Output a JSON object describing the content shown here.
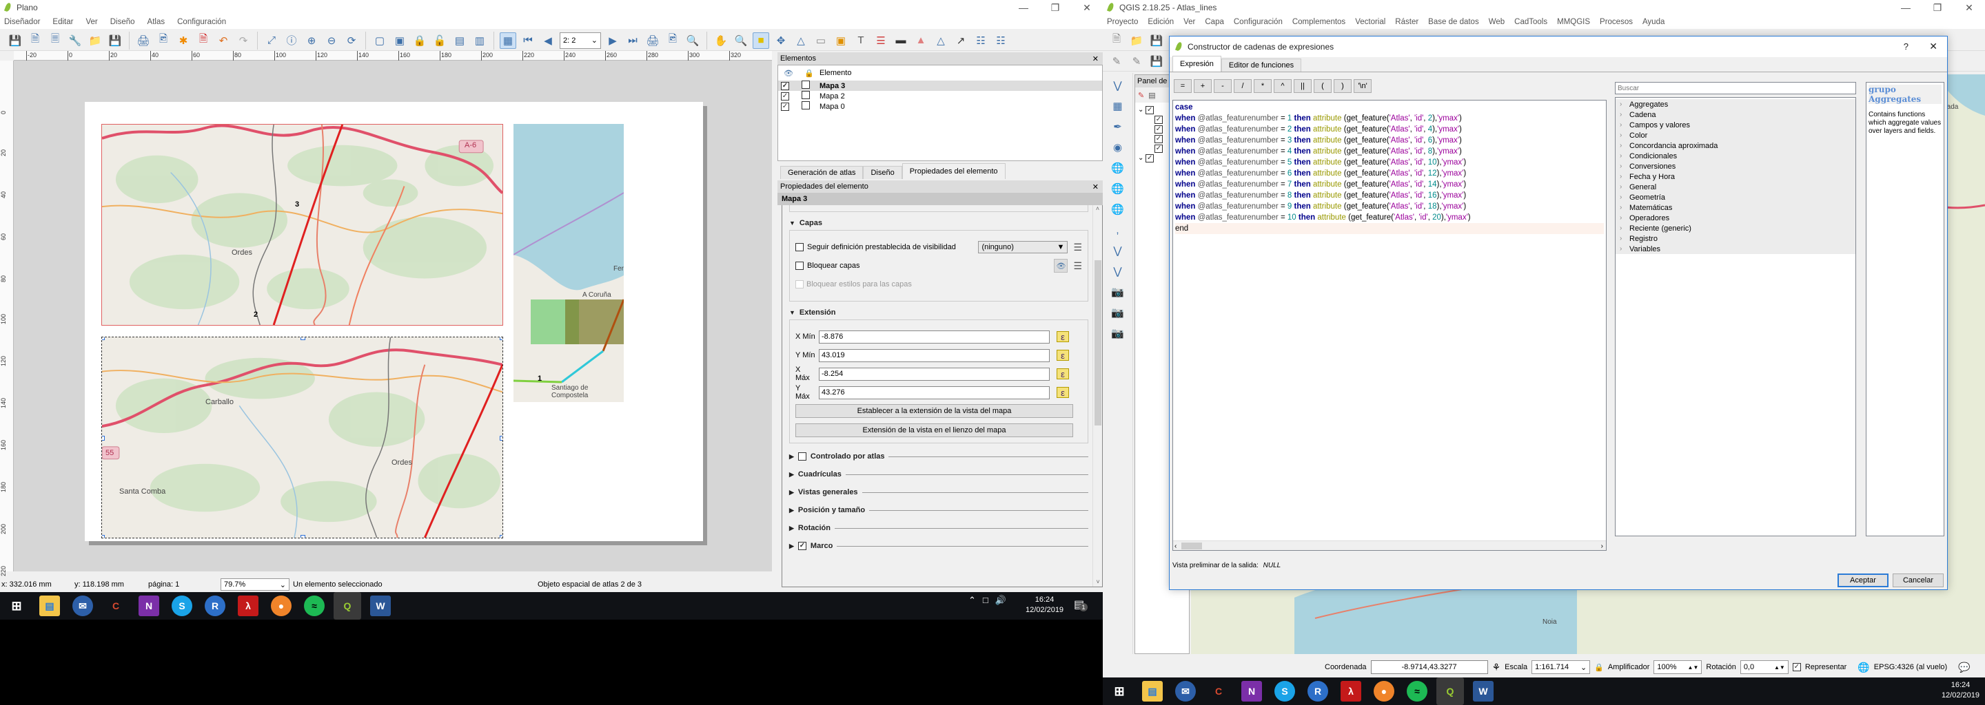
{
  "left_window": {
    "title": "Plano",
    "menu": [
      "Diseñador",
      "Editar",
      "Ver",
      "Diseño",
      "Atlas",
      "Configuración"
    ],
    "atlas_page_combo": "2: 2",
    "ruler_h": [
      "-20",
      "0",
      "20",
      "40",
      "60",
      "80",
      "100",
      "120",
      "140",
      "160",
      "180",
      "200",
      "220",
      "240",
      "260",
      "280",
      "300",
      "320"
    ],
    "ruler_v": [
      "0",
      "20",
      "40",
      "60",
      "80",
      "100",
      "120",
      "140",
      "160",
      "180",
      "200",
      "220"
    ],
    "map_labels": {
      "a6": "A-6",
      "ordes": "Ordes",
      "carballo": "Carballo",
      "ordes2": "Ordes",
      "santa_comba": "Santa Comba",
      "n55": "55",
      "ferrol": "Fer",
      "a_coruna": "A Coruña",
      "santiago": "Santiago de Compostela",
      "m1": "1",
      "m2": "2",
      "m3": "3"
    },
    "elements_panel": {
      "title": "Elementos",
      "column_header": "Elemento",
      "items": [
        {
          "name": "Mapa 3",
          "visible": true,
          "locked": false,
          "selected": true
        },
        {
          "name": "Mapa 2",
          "visible": true,
          "locked": false,
          "selected": false
        },
        {
          "name": "Mapa 0",
          "visible": true,
          "locked": false,
          "selected": false
        }
      ]
    },
    "tabs": [
      "Generación de atlas",
      "Diseño",
      "Propiedades del elemento"
    ],
    "active_tab": "Propiedades del elemento",
    "properties": {
      "title": "Propiedades del elemento",
      "item_name": "Mapa 3",
      "capas": {
        "title": "Capas",
        "follow_preset_label": "Seguir definición prestablecida de visibilidad",
        "follow_preset_checked": false,
        "preset_value": "(ninguno)",
        "lock_layers_label": "Bloquear capas",
        "lock_layers_checked": false,
        "lock_styles_label": "Bloquear estilos para las capas",
        "lock_styles_checked": false
      },
      "extent": {
        "title": "Extensión",
        "xmin_label": "X Mín",
        "xmin": "-8.876",
        "ymin_label": "Y Mín",
        "ymin": "43.019",
        "xmax_label": "X Máx",
        "xmax": "-8.254",
        "ymax_label": "Y Máx",
        "ymax": "43.276",
        "set_extent_button": "Establecer a la extensión de la vista del mapa",
        "view_extent_button": "Extensión de la vista en el lienzo del mapa"
      },
      "collapsed_sections": [
        {
          "label": "Controlado por atlas",
          "checkbox": true,
          "checked": false
        },
        {
          "label": "Cuadrículas",
          "checkbox": false
        },
        {
          "label": "Vistas generales",
          "checkbox": false
        },
        {
          "label": "Posición y tamaño",
          "checkbox": false
        },
        {
          "label": "Rotación",
          "checkbox": false
        },
        {
          "label": "Marco",
          "checkbox": true,
          "checked": true
        }
      ]
    },
    "statusbar": {
      "x": "x: 332.016 mm",
      "y": "y: 118.198 mm",
      "page": "página: 1",
      "zoom": "79.7%",
      "selection": "Un elemento seleccionado",
      "atlas": "Objeto espacial de atlas 2 de 3"
    }
  },
  "right_window": {
    "title": "QGIS 2.18.25 - Atlas_lines",
    "menu": [
      "Proyecto",
      "Edición",
      "Ver",
      "Capa",
      "Configuración",
      "Complementos",
      "Vectorial",
      "Ráster",
      "Base de datos",
      "Web",
      "CadTools",
      "MMQGIS",
      "Procesos",
      "Ayuda"
    ],
    "layers_panel_title": "Panel de capas",
    "statusbar": {
      "coord_label": "Coordenada",
      "coord_value": "-8.9714,43.3277",
      "scale_label": "Escala",
      "scale_value": "1:161.714",
      "magnifier_label": "Amplificador",
      "magnifier_value": "100%",
      "rotation_label": "Rotación",
      "rotation_value": "0,0",
      "render_label": "Representar",
      "render_checked": true,
      "crs": "EPSG:4326 (al vuelo)"
    },
    "map_labels": {
      "sada": "Sada",
      "noia": "Noia"
    }
  },
  "dialog": {
    "title": "Constructor de cadenas de expresiones",
    "help": "?",
    "tabs": [
      "Expresión",
      "Editor de funciones"
    ],
    "active_tab": "Expresión",
    "operators": [
      "=",
      "+",
      "-",
      "/",
      "*",
      "^",
      "||",
      "(",
      ")",
      "'\\n'"
    ],
    "expression": {
      "first": "case",
      "lines": [
        {
          "when": "when",
          "var": "@atlas_featurenumber",
          "op": "=",
          "n": "1",
          "then": "then",
          "fn": "attribute",
          "args1": "(get_feature(",
          "s1": "'Atlas'",
          "s2": "'id'",
          "id": "2",
          "field": "'ymax'"
        },
        {
          "when": "when",
          "var": "@atlas_featurenumber",
          "op": "=",
          "n": "2",
          "then": "then",
          "fn": "attribute",
          "args1": "(get_feature(",
          "s1": "'Atlas'",
          "s2": "'id'",
          "id": "4",
          "field": "'ymax'"
        },
        {
          "when": "when",
          "var": "@atlas_featurenumber",
          "op": "=",
          "n": "3",
          "then": "then",
          "fn": "attribute",
          "args1": "(get_feature(",
          "s1": "'Atlas'",
          "s2": "'id'",
          "id": "6",
          "field": "'ymax'"
        },
        {
          "when": "when",
          "var": "@atlas_featurenumber",
          "op": "=",
          "n": "4",
          "then": "then",
          "fn": "attribute",
          "args1": "(get_feature(",
          "s1": "'Atlas'",
          "s2": "'id'",
          "id": "8",
          "field": "'ymax'"
        },
        {
          "when": "when",
          "var": "@atlas_featurenumber",
          "op": "=",
          "n": "5",
          "then": "then",
          "fn": "attribute",
          "args1": "(get_feature(",
          "s1": "'Atlas'",
          "s2": "'id'",
          "id": "10",
          "field": "'ymax'"
        },
        {
          "when": "when",
          "var": "@atlas_featurenumber",
          "op": "=",
          "n": "6",
          "then": "then",
          "fn": "attribute",
          "args1": "(get_feature(",
          "s1": "'Atlas'",
          "s2": "'id'",
          "id": "12",
          "field": "'ymax'"
        },
        {
          "when": "when",
          "var": "@atlas_featurenumber",
          "op": "=",
          "n": "7",
          "then": "then",
          "fn": "attribute",
          "args1": "(get_feature(",
          "s1": "'Atlas'",
          "s2": "'id'",
          "id": "14",
          "field": "'ymax'"
        },
        {
          "when": "when",
          "var": "@atlas_featurenumber",
          "op": "=",
          "n": "8",
          "then": "then",
          "fn": "attribute",
          "args1": "(get_feature(",
          "s1": "'Atlas'",
          "s2": "'id'",
          "id": "16",
          "field": "'ymax'"
        },
        {
          "when": "when",
          "var": "@atlas_featurenumber",
          "op": "=",
          "n": "9",
          "then": "then",
          "fn": "attribute",
          "args1": "(get_feature(",
          "s1": "'Atlas'",
          "s2": "'id'",
          "id": "18",
          "field": "'ymax'"
        },
        {
          "when": "when",
          "var": "@atlas_featurenumber",
          "op": "=",
          "n": "10",
          "then": "then",
          "fn": "attribute",
          "args1": "(get_feature(",
          "s1": "'Atlas'",
          "s2": "'id'",
          "id": "20",
          "field": "'ymax'"
        }
      ],
      "last": "end"
    },
    "search_placeholder": "Buscar",
    "function_groups": [
      "Aggregates",
      "Cadena",
      "Campos y valores",
      "Color",
      "Concordancia aproximada",
      "Condicionales",
      "Conversiones",
      "Fecha y Hora",
      "General",
      "Geometría",
      "Matemáticas",
      "Operadores",
      "Reciente (generic)",
      "Registro",
      "Variables"
    ],
    "help_title": "grupo Aggregates",
    "help_text": "Contains functions which aggregate values over layers and fields.",
    "preview_label": "Vista preliminar de la salida:",
    "preview_value": "NULL",
    "ok": "Aceptar",
    "cancel": "Cancelar"
  },
  "taskbar_left": {
    "apps": [
      "windows-start",
      "file-explorer",
      "thunderbird",
      "ccleaner",
      "onenote",
      "skype",
      "r",
      "acrobat",
      "firefox",
      "spotify",
      "qgis",
      "word"
    ],
    "time": "16:24",
    "date": "12/02/2019",
    "notifications": "1"
  },
  "taskbar_right": {
    "time": "16:24",
    "date": "12/02/2019"
  },
  "colors": {
    "accent": "#2b7bd6",
    "route": "#e02020",
    "keyword": "#00008b",
    "string": "#9b009b",
    "function": "#999900",
    "number": "#008b8b"
  }
}
